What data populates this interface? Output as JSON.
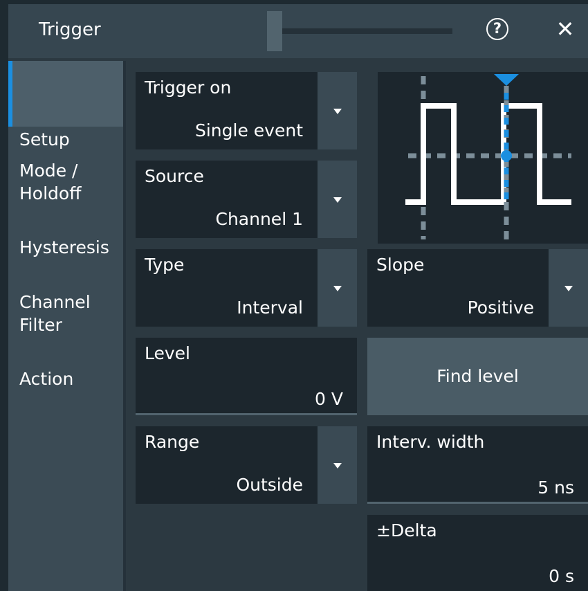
{
  "window": {
    "title": "Trigger",
    "help_label": "?",
    "close_label": "✕"
  },
  "sidebar": {
    "items": [
      {
        "label": "Setup",
        "active": true
      },
      {
        "label": "Mode /\nHoldoff",
        "active": false
      },
      {
        "label": "Hysteresis",
        "active": false
      },
      {
        "label": "Channel\nFilter",
        "active": false
      },
      {
        "label": "Action",
        "active": false
      }
    ]
  },
  "fields": {
    "trigger_on": {
      "label": "Trigger on",
      "value": "Single event"
    },
    "source": {
      "label": "Source",
      "value": "Channel 1"
    },
    "type": {
      "label": "Type",
      "value": "Interval"
    },
    "slope": {
      "label": "Slope",
      "value": "Positive"
    },
    "level": {
      "label": "Level",
      "value": "0 V"
    },
    "find_level": {
      "label": "Find level"
    },
    "range": {
      "label": "Range",
      "value": "Outside"
    },
    "interval_width": {
      "label": "Interv. width",
      "value": "5 ns"
    },
    "delta": {
      "label": "±Delta",
      "value": "0 s"
    }
  },
  "colors": {
    "accent": "#1b8fe0",
    "panel": "#2c3941",
    "field": "#1c262d",
    "button": "#4a5c66"
  },
  "icons": {
    "help": "help-icon",
    "close": "close-icon",
    "dropdown": "chevron-down-icon",
    "preview": "interval-trigger-waveform-icon"
  }
}
